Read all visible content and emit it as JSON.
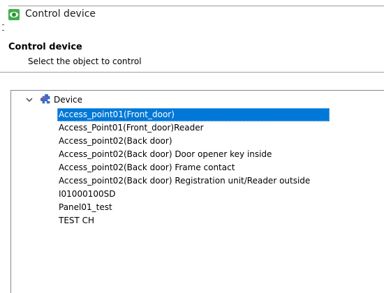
{
  "window": {
    "title": "Control device",
    "icon": "eye-icon",
    "accent_color": "#3fae49"
  },
  "header": {
    "title": "Control device",
    "subtitle": "Select the object to control"
  },
  "tree": {
    "root": {
      "label": "Device",
      "icon": "device-puzzle-icon",
      "expanded": true
    },
    "selected_color": "#0078d7",
    "items": [
      {
        "label": "Access_point01(Front_door)",
        "selected": true
      },
      {
        "label": "Access_Point01(Front_door)Reader",
        "selected": false
      },
      {
        "label": "Access_point02(Back door)",
        "selected": false
      },
      {
        "label": "Access_point02(Back door) Door opener key inside",
        "selected": false
      },
      {
        "label": "Access_point02(Back door) Frame contact",
        "selected": false
      },
      {
        "label": "Access_point02(Back door) Registration unit/Reader outside",
        "selected": false
      },
      {
        "label": "I01000100SD",
        "selected": false
      },
      {
        "label": "Panel01_test",
        "selected": false
      },
      {
        "label": "TEST CH",
        "selected": false
      }
    ]
  }
}
